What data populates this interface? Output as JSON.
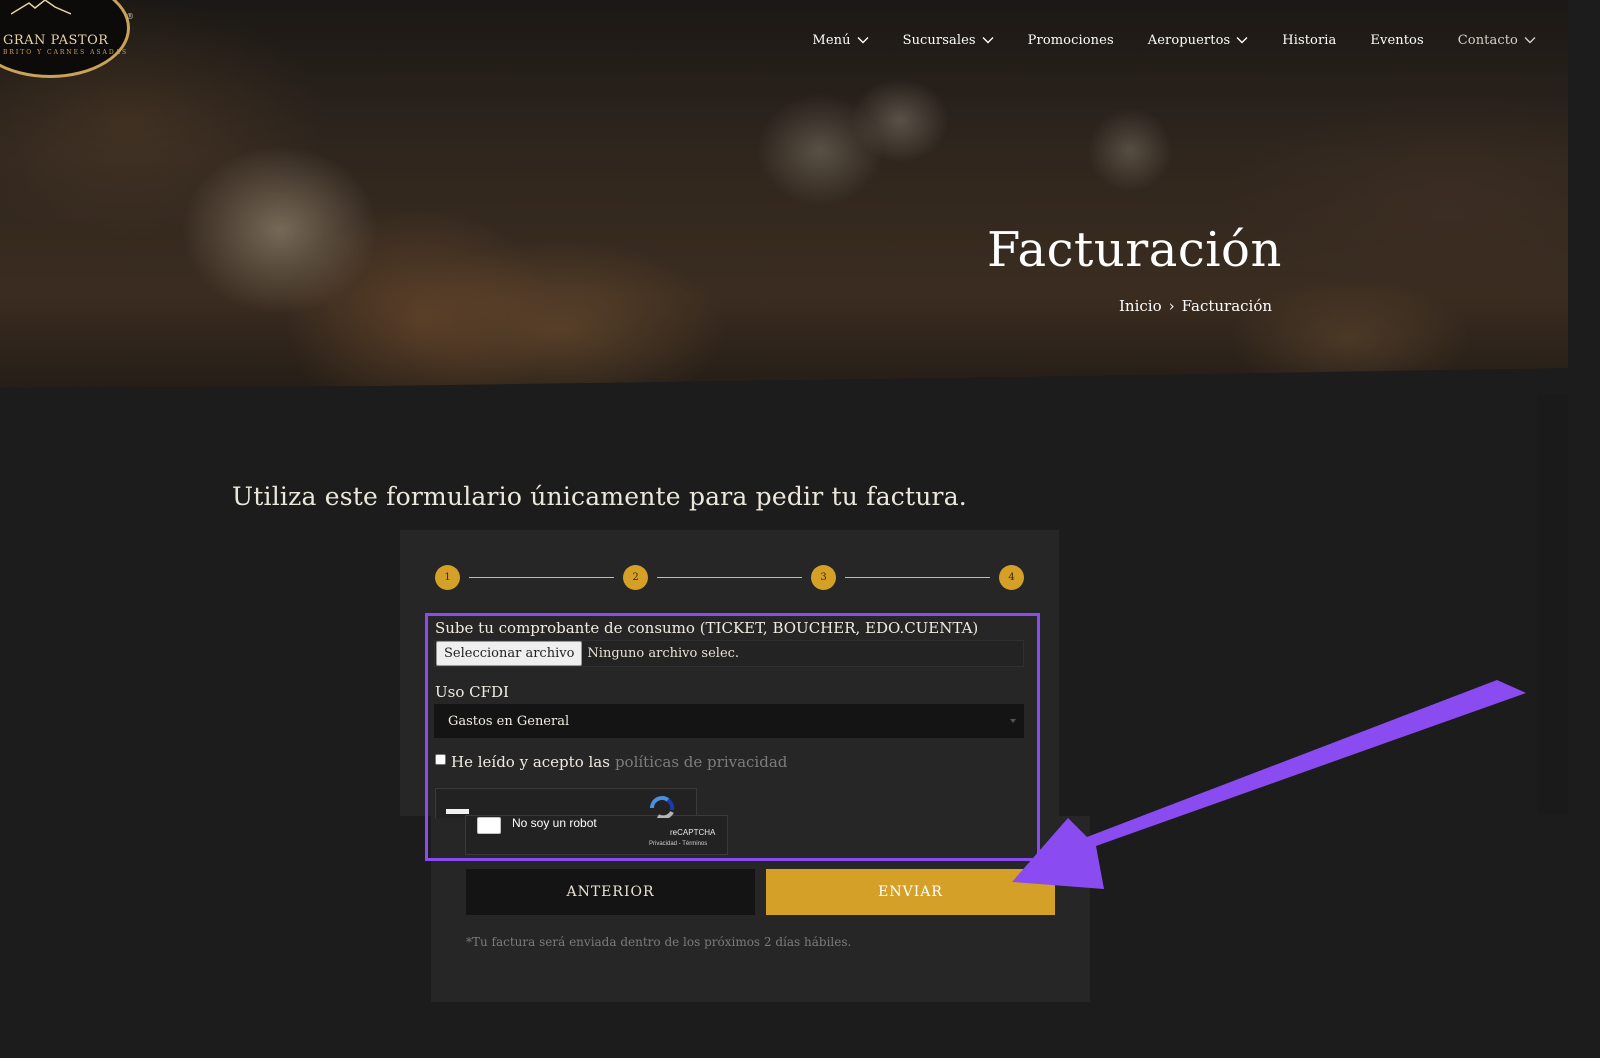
{
  "brand": {
    "name": "GRAN PASTOR",
    "tagline": "BRITO Y CARNES ASADAS",
    "registered": "®"
  },
  "nav": {
    "items": [
      {
        "label": "Menú",
        "dropdown": true
      },
      {
        "label": "Sucursales",
        "dropdown": true
      },
      {
        "label": "Promociones",
        "dropdown": false
      },
      {
        "label": "Aeropuertos",
        "dropdown": true
      },
      {
        "label": "Historia",
        "dropdown": false
      },
      {
        "label": "Eventos",
        "dropdown": false
      },
      {
        "label": "Contacto",
        "dropdown": true
      }
    ]
  },
  "hero": {
    "title": "Facturación",
    "breadcrumb": {
      "home": "Inicio",
      "separator": "›",
      "current": "Facturación"
    }
  },
  "intro": "Utiliza este formulario únicamente para pedir tu factura.",
  "form": {
    "steps": [
      "1",
      "2",
      "3",
      "4"
    ],
    "upload_label": "Sube tu comprobante de consumo (TICKET, BOUCHER, EDO.CUENTA)",
    "upload_button": "Seleccionar archivo",
    "upload_status": "Ninguno archivo selec.",
    "cfdi_label": "Uso CFDI",
    "cfdi_value": "Gastos en General",
    "privacy_text": "He leído y acepto las",
    "privacy_link": "políticas de privacidad",
    "captcha": {
      "label": "No soy un robot",
      "brand": "reCAPTCHA",
      "terms": "Privacidad - Términos"
    },
    "prev_button": "ANTERIOR",
    "submit_button": "ENVIAR",
    "note": "*Tu factura será enviada dentro de los próximos 2 días hábiles."
  },
  "colors": {
    "accent": "#d4a027",
    "highlight": "#8a4cf0",
    "background": "#1c1c1c",
    "panel": "#262626"
  }
}
